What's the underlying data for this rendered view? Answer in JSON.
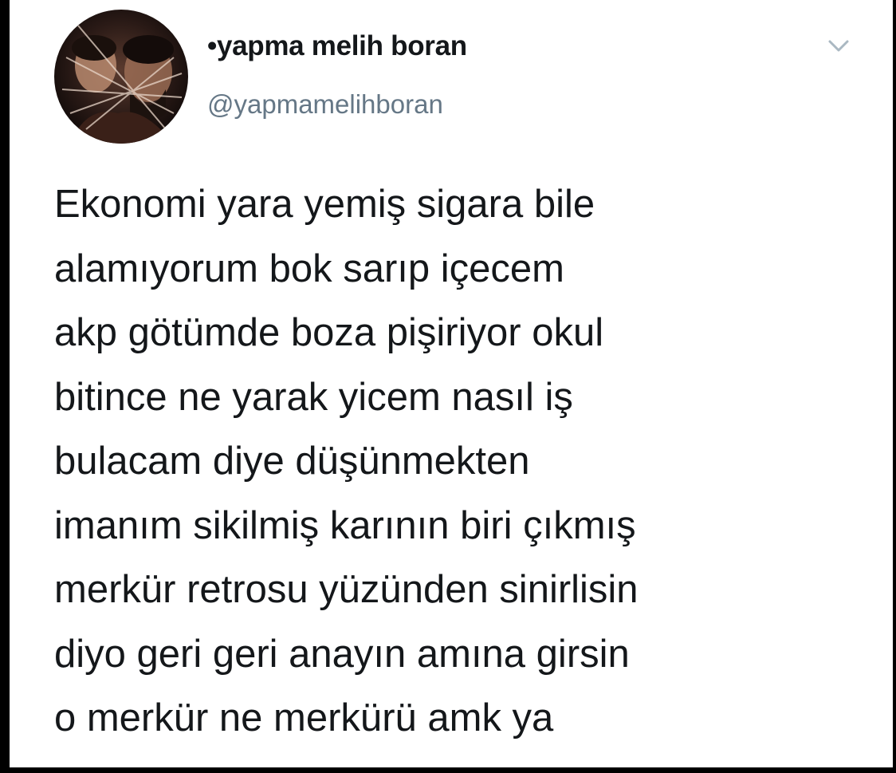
{
  "tweet": {
    "author": {
      "display_name": "•yapma melih boran",
      "handle": "@yapmamelihboran"
    },
    "menu_icon": "chevron-down-icon",
    "text_lines": [
      "Ekonomi yara yemiş sigara bile",
      "alamıyorum bok sarıp içecem",
      "akp götümde boza pişiriyor okul",
      "bitince ne yarak yicem nasıl iş",
      "bulacam diye düşünmekten",
      "imanım sikilmiş karının biri çıkmış",
      "merkür retrosu yüzünden sinirlisin",
      "diyo geri geri anayın amına girsin",
      "o merkür ne merkürü amk ya"
    ]
  },
  "colors": {
    "background": "#ffffff",
    "text": "#14171a",
    "secondary_text": "#657786",
    "caret": "#aab8c2",
    "outer_frame": "#000000"
  }
}
